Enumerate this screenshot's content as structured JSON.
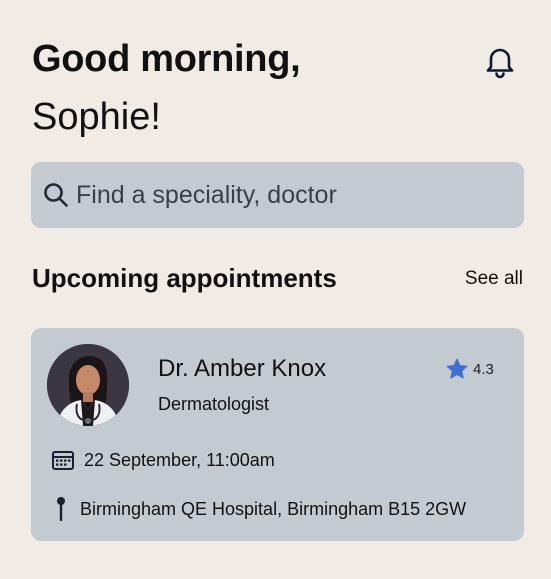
{
  "header": {
    "greeting_line1": "Good morning,",
    "greeting_line2": "Sophie!",
    "notifications_icon": "bell-icon"
  },
  "search": {
    "placeholder": "Find a speciality, doctor",
    "icon": "search-icon"
  },
  "appointments": {
    "title": "Upcoming appointments",
    "see_all_label": "See all",
    "items": [
      {
        "doctor_name": "Dr. Amber Knox",
        "specialty": "Dermatologist",
        "rating": "4.3",
        "datetime": "22 September, 11:00am",
        "location": "Birmingham QE Hospital, Birmingham B15 2GW",
        "icons": {
          "rating": "star-icon",
          "date": "calendar-icon",
          "location": "location-pin-icon"
        }
      }
    ]
  },
  "colors": {
    "background": "#f0ebe4",
    "card": "#c3cbd0",
    "accent_star": "#3f6fd6",
    "text": "#111111"
  }
}
